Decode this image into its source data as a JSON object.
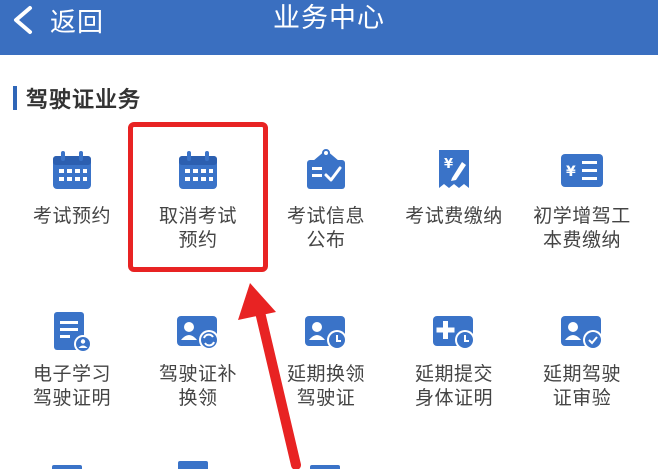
{
  "header": {
    "back_label": "返回",
    "title": "业务中心"
  },
  "section": {
    "title": "驾驶证业务"
  },
  "tiles_row1": [
    {
      "label_line1": "考试预约",
      "label_line2": "",
      "icon": "calendar-icon"
    },
    {
      "label_line1": "取消考试",
      "label_line2": "预约",
      "icon": "calendar-icon"
    },
    {
      "label_line1": "考试信息",
      "label_line2": "公布",
      "icon": "clipboard-check-icon"
    },
    {
      "label_line1": "考试费缴纳",
      "label_line2": "",
      "icon": "yuan-receipt-icon"
    },
    {
      "label_line1": "初学增驾工",
      "label_line2": "本费缴纳",
      "icon": "yuan-card-icon"
    }
  ],
  "tiles_row2": [
    {
      "label_line1": "电子学习",
      "label_line2": "驾驶证明",
      "icon": "document-user-icon"
    },
    {
      "label_line1": "驾驶证补",
      "label_line2": "换领",
      "icon": "id-card-refresh-icon"
    },
    {
      "label_line1": "延期换领",
      "label_line2": "驾驶证",
      "icon": "id-card-clock-icon"
    },
    {
      "label_line1": "延期提交",
      "label_line2": "身体证明",
      "icon": "medical-clock-icon"
    },
    {
      "label_line1": "延期驾驶",
      "label_line2": "证审验",
      "icon": "id-card-check-icon"
    }
  ],
  "colors": {
    "header_bg": "#3a6fc0",
    "icon_blue": "#3a73c8",
    "highlight": "#e82323"
  }
}
